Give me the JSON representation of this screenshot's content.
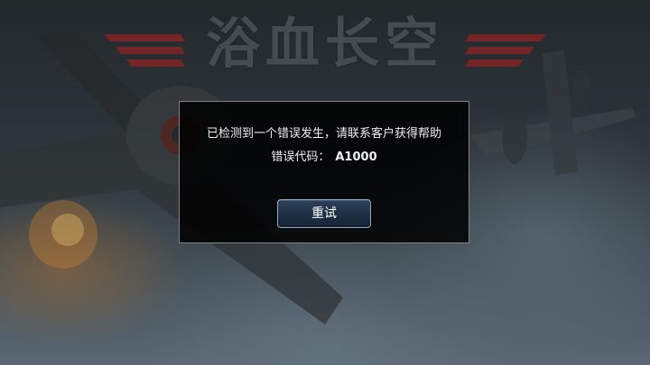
{
  "game": {
    "title": "浴血长空"
  },
  "dialog": {
    "message": "已检测到一个错误发生，请联系客户获得帮助",
    "code_label": "错误代码：",
    "code_value": "A1000",
    "retry_label": "重试"
  },
  "colors": {
    "dialog_bg": "#000000",
    "dialog_border": "#7d8388",
    "button_border": "#8fa8bf",
    "logo_stripe": "#b8312f"
  }
}
